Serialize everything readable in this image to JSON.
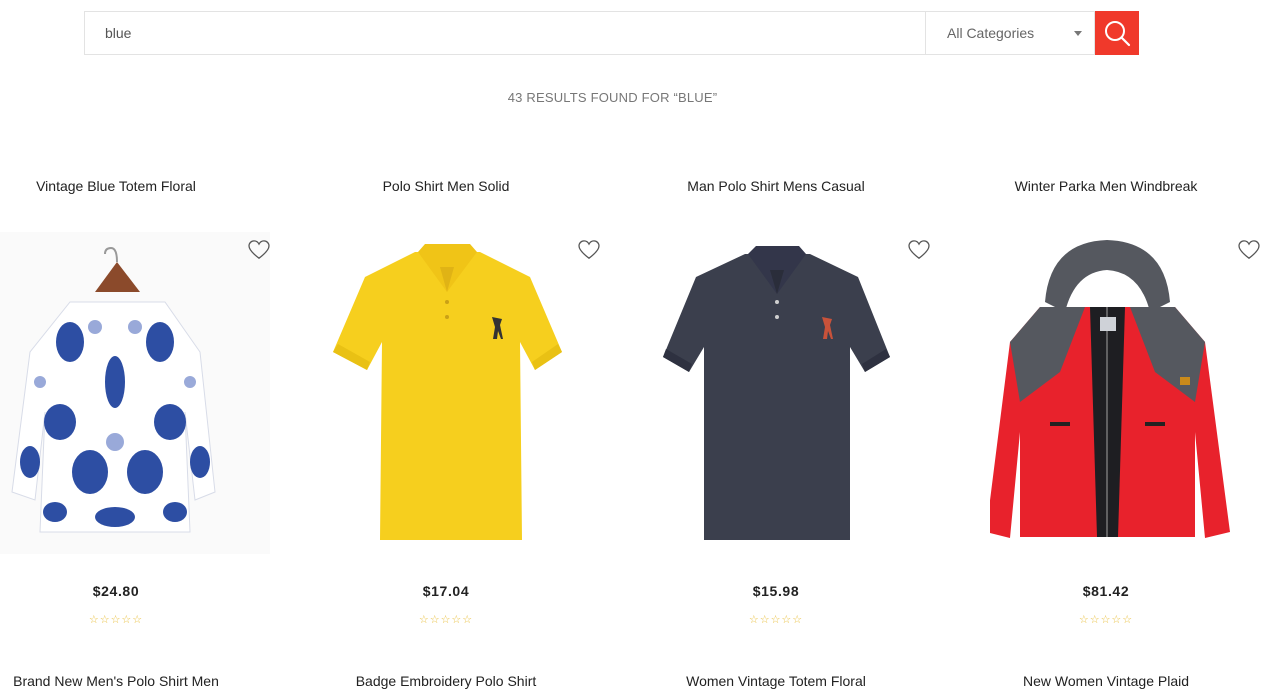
{
  "search": {
    "value": "blue",
    "category": "All Categories"
  },
  "results": {
    "summary": "43 RESULTS FOUND FOR “BLUE”"
  },
  "icons": {
    "search": "search-icon",
    "wishlist": "heart-outline-icon",
    "dropdown": "caret-down-icon"
  },
  "colors": {
    "accent": "#f0392b",
    "star": "#e9bf3c"
  },
  "products": [
    {
      "title": "Vintage Blue Totem Floral",
      "price": "$24.80",
      "rating": 0,
      "stars": "☆☆☆☆☆"
    },
    {
      "title": "Polo Shirt Men Solid",
      "price": "$17.04",
      "rating": 0,
      "stars": "☆☆☆☆☆"
    },
    {
      "title": "Man Polo Shirt Mens Casual",
      "price": "$15.98",
      "rating": 0,
      "stars": "☆☆☆☆☆"
    },
    {
      "title": "Winter Parka Men Windbreak",
      "price": "$81.42",
      "rating": 0,
      "stars": "☆☆☆☆☆"
    }
  ],
  "next_row": [
    {
      "title": "Brand New Men's Polo Shirt Men"
    },
    {
      "title": "Badge Embroidery Polo Shirt"
    },
    {
      "title": "Women Vintage Totem Floral"
    },
    {
      "title": "New Women Vintage Plaid"
    }
  ]
}
